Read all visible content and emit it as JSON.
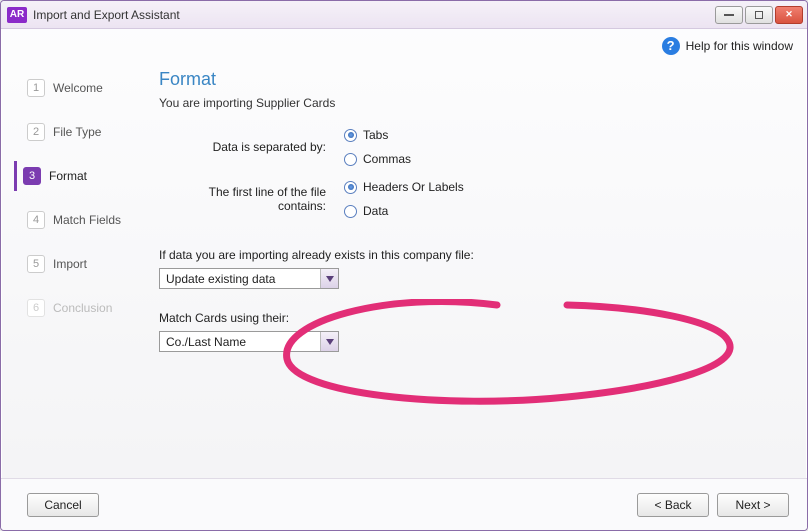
{
  "window": {
    "app_badge": "AR",
    "title": "Import and Export Assistant",
    "help_label": "Help for this window"
  },
  "sidebar": {
    "steps": [
      {
        "num": "1",
        "label": "Welcome"
      },
      {
        "num": "2",
        "label": "File Type"
      },
      {
        "num": "3",
        "label": "Format"
      },
      {
        "num": "4",
        "label": "Match Fields"
      },
      {
        "num": "5",
        "label": "Import"
      },
      {
        "num": "6",
        "label": "Conclusion"
      }
    ],
    "active_index": 2,
    "disabled_indexes": [
      5
    ]
  },
  "main": {
    "title": "Format",
    "subtitle": "You are importing Supplier Cards",
    "separator_label": "Data is separated by:",
    "separator_options": [
      "Tabs",
      "Commas"
    ],
    "separator_selected": "Tabs",
    "firstline_label": "The first line of the file contains:",
    "firstline_options": [
      "Headers Or Labels",
      "Data"
    ],
    "firstline_selected": "Headers Or Labels",
    "exists_label": "If data you are importing already exists in this company file:",
    "exists_value": "Update existing data",
    "match_label": "Match Cards using their:",
    "match_value": "Co./Last Name"
  },
  "footer": {
    "cancel": "Cancel",
    "back": "< Back",
    "next": "Next >"
  }
}
